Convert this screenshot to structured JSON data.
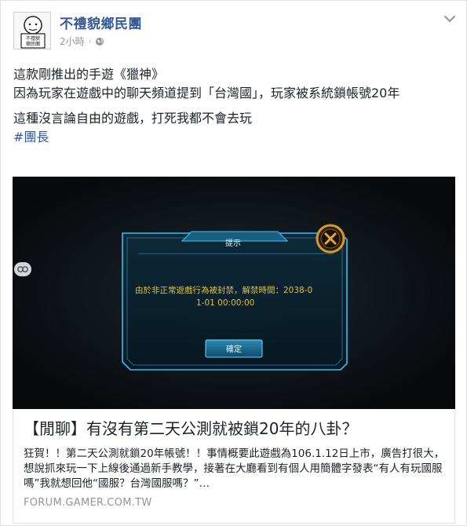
{
  "post": {
    "page_name": "不禮貌鄉民團",
    "timestamp": "2小時",
    "separator": "·",
    "privacy_icon": "globe-icon",
    "avatar_text_top": "不禮貌",
    "avatar_text_bottom": "鄉民團",
    "menu_icon": "chevron-down-icon"
  },
  "body": {
    "line1": "這款剛推出的手遊《獵神》",
    "line2": "因為玩家在遊戲中的聊天頻道提到「台灣國」，玩家被系統鎖帳號20年",
    "line3": "這種沒言論自由的遊戲，打死我都不會去玩",
    "hashtag": "#團長"
  },
  "media": {
    "dialog_title": "提示",
    "dialog_message_line1": "由於非正常遊戲行為被封禁，解禁時間：2038-0",
    "dialog_message_line2": "1-01 00:00:00",
    "confirm_label": "確定",
    "close_icon": "close-icon",
    "side_icon": "link-icon",
    "colors": {
      "glow": "#3ec6ff",
      "close_ring": "#d79a2a",
      "message": "#e4be3a"
    }
  },
  "link": {
    "title": "【閒聊】有沒有第二天公測就被鎖20年的八卦？",
    "description": "狂賀！！第二天公測就鎖20年帳號！！事情概要此遊戲為106.1.12日上市，廣告打很大，想說抓來玩一下上線後通過新手教學，接著在大廳看到有個人用簡體字發表“有人有玩國服嗎”我就想回他“國服？台灣國服嗎？”…",
    "source": "FORUM.GAMER.COM.TW"
  }
}
